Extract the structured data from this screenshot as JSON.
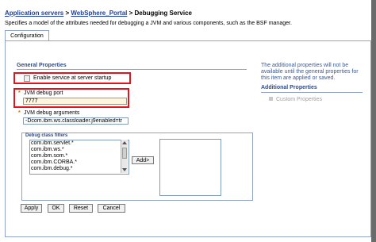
{
  "breadcrumb": {
    "items": [
      "Application servers",
      "WebSphere_Portal"
    ],
    "separator": ">",
    "current": "Debugging Service"
  },
  "description": "Specifies a model of the attributes needed for debugging a JVM and various components, such as the BSF manager.",
  "tabs": [
    {
      "label": "Configuration"
    }
  ],
  "general": {
    "title": "General Properties",
    "enable_label": "Enable service at server startup",
    "enable_checked": false,
    "required_mark": "*",
    "port_label": "JVM debug port",
    "port_value": "7777",
    "args_label": "JVM debug arguments",
    "args_value": "-Dcom.ibm.ws.classloader.j9enabled=tr"
  },
  "filters": {
    "title": "Debug class filters",
    "items": [
      "com.ibm.servlet.*",
      "com.ibm.ws.*",
      "com.ibm.som.*",
      "com.ibm.CORBA.*",
      "com.ibm.debug.*"
    ],
    "add_label": "Add>"
  },
  "buttons": {
    "apply": "Apply",
    "ok": "OK",
    "reset": "Reset",
    "cancel": "Cancel"
  },
  "right": {
    "note": "The additional properties will not be available until the general properties for this item are applied or saved.",
    "additional_title": "Additional Properties",
    "custom_props": "Custom Properties"
  },
  "colors": {
    "highlight": "#e0141e",
    "link": "#1f3f9f",
    "section": "#2d4b8c"
  }
}
